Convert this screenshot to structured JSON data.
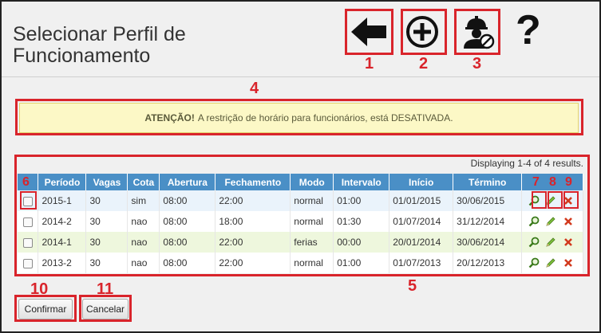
{
  "page": {
    "title": "Selecionar Perfil de Funcionamento"
  },
  "toolbar": {
    "back_icon": "arrow-left-icon",
    "add_icon": "plus-circle-icon",
    "worker_icon": "worker-block-icon",
    "help_icon": "question-mark-icon",
    "help_glyph": "?"
  },
  "alert": {
    "strong": "ATENÇÃO!",
    "text": "A restrição de horário para funcionários, está DESATIVADA."
  },
  "grid": {
    "summary": "Displaying 1-4 of 4 results.",
    "columns": [
      "Período",
      "Vagas",
      "Cota",
      "Abertura",
      "Fechamento",
      "Modo",
      "Intervalo",
      "Início",
      "Término"
    ],
    "rows": [
      {
        "periodo": "2015-1",
        "vagas": "30",
        "cota": "sim",
        "abertura": "08:00",
        "fechamento": "22:00",
        "modo": "normal",
        "intervalo": "01:00",
        "inicio": "01/01/2015",
        "termino": "30/06/2015"
      },
      {
        "periodo": "2014-2",
        "vagas": "30",
        "cota": "nao",
        "abertura": "08:00",
        "fechamento": "18:00",
        "modo": "normal",
        "intervalo": "01:30",
        "inicio": "01/07/2014",
        "termino": "31/12/2014"
      },
      {
        "periodo": "2014-1",
        "vagas": "30",
        "cota": "nao",
        "abertura": "08:00",
        "fechamento": "22:00",
        "modo": "ferias",
        "intervalo": "00:00",
        "inicio": "20/01/2014",
        "termino": "30/06/2014"
      },
      {
        "periodo": "2013-2",
        "vagas": "30",
        "cota": "nao",
        "abertura": "08:00",
        "fechamento": "22:00",
        "modo": "normal",
        "intervalo": "01:00",
        "inicio": "01/07/2013",
        "termino": "20/12/2013"
      }
    ],
    "row_action_icons": [
      "magnifier-icon",
      "pencil-icon",
      "delete-x-icon"
    ]
  },
  "buttons": {
    "confirm_label": "Confirmar",
    "cancel_label": "Cancelar"
  },
  "callouts": [
    "1",
    "2",
    "3",
    "4",
    "5",
    "6",
    "7",
    "8",
    "9",
    "10",
    "11"
  ],
  "colors": {
    "callout_red": "#d9242b",
    "header_blue": "#4a8fc6",
    "alert_bg": "#fcf8c6",
    "row_highlight_green": "#eef7dd",
    "row_highlight_blue": "#eaf3fb"
  }
}
